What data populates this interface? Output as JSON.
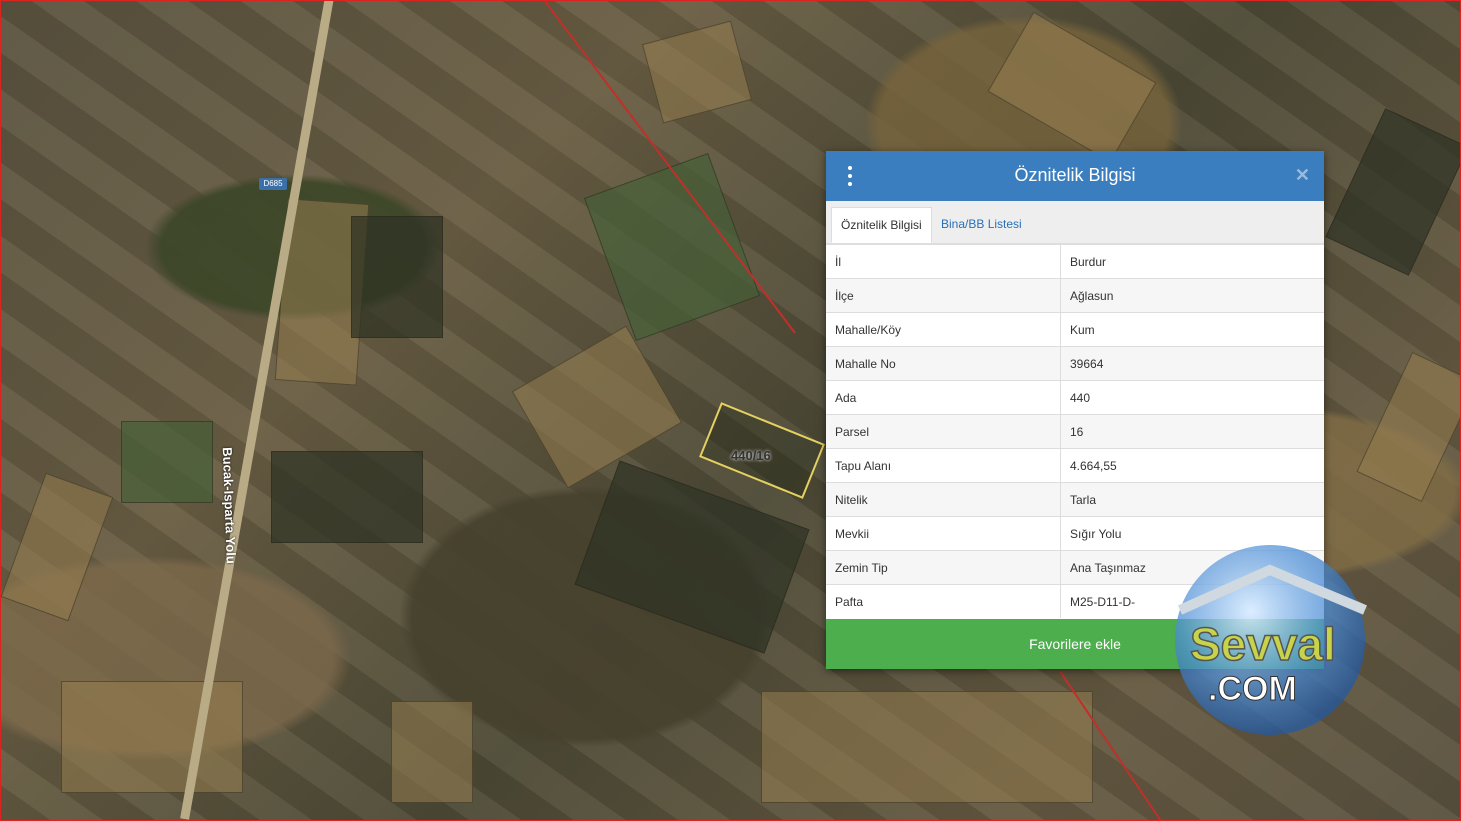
{
  "map": {
    "road_label": "Bucak-Isparta Yolu",
    "road_shield": "D685",
    "parcel_label": "440/16"
  },
  "panel": {
    "title": "Öznitelik Bilgisi",
    "tabs": [
      {
        "label": "Öznitelik Bilgisi"
      },
      {
        "label": "Bina/BB Listesi"
      }
    ],
    "rows": [
      {
        "key": "İl",
        "value": "Burdur"
      },
      {
        "key": "İlçe",
        "value": "Ağlasun"
      },
      {
        "key": "Mahalle/Köy",
        "value": "Kum"
      },
      {
        "key": "Mahalle No",
        "value": "39664"
      },
      {
        "key": "Ada",
        "value": "440"
      },
      {
        "key": "Parsel",
        "value": "16"
      },
      {
        "key": "Tapu Alanı",
        "value": "4.664,55"
      },
      {
        "key": "Nitelik",
        "value": "Tarla"
      },
      {
        "key": "Mevkii",
        "value": "Sığır Yolu"
      },
      {
        "key": "Zemin Tip",
        "value": "Ana Taşınmaz"
      },
      {
        "key": "Pafta",
        "value": "M25-D11-D-"
      }
    ],
    "favorite_button": "Favorilere ekle"
  },
  "watermark": {
    "line1": "Sevval",
    "line2": ".COM"
  },
  "colors": {
    "header": "#3a7ebf",
    "button": "#4cae4c",
    "parcel_outline": "#e4d160",
    "boundary": "#c0302a"
  }
}
